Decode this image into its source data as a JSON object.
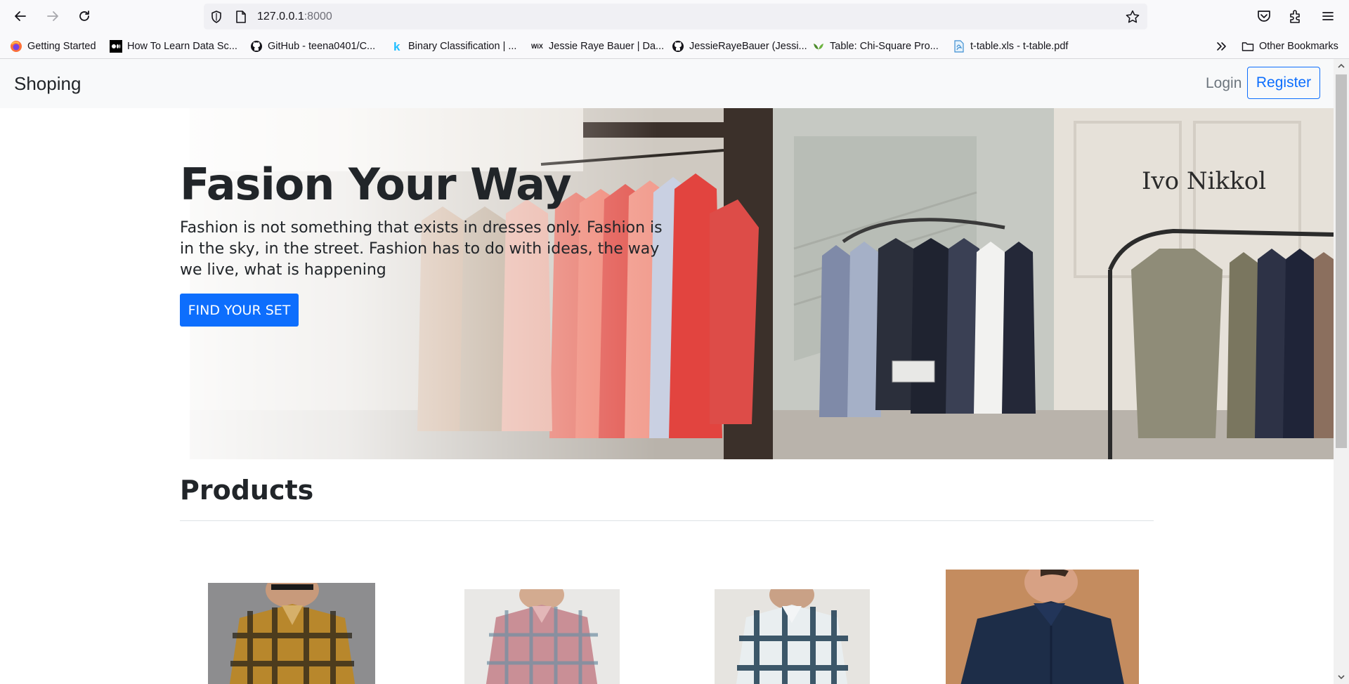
{
  "browser": {
    "url_host": "127.0.0.1",
    "url_port": ":8000",
    "bookmarks": [
      {
        "label": "Getting Started",
        "icon": "firefox-icon"
      },
      {
        "label": "How To Learn Data Sc...",
        "icon": "medium-icon"
      },
      {
        "label": "GitHub - teena0401/C...",
        "icon": "github-icon"
      },
      {
        "label": "Binary Classification | ...",
        "icon": "kaggle-icon"
      },
      {
        "label": "Jessie Raye Bauer | Da...",
        "icon": "wix-icon"
      },
      {
        "label": "JessieRayeBauer (Jessi...",
        "icon": "github-icon"
      },
      {
        "label": "Table: Chi-Square Pro...",
        "icon": "leaf-icon"
      },
      {
        "label": "t-table.xls - t-table.pdf",
        "icon": "pdf-icon"
      }
    ],
    "other_bookmarks": "Other Bookmarks"
  },
  "navbar": {
    "brand": "Shoping",
    "login": "Login",
    "register": "Register"
  },
  "hero": {
    "title": "Fasion Your Way",
    "text": "Fashion is not something that exists in dresses only. Fashion is in the sky, in the street. Fashion has to do with ideas, the way we live, what is happening",
    "button": "FIND YOUR SET",
    "store_sign": "Ivo Nikkol"
  },
  "products": {
    "title": "Products"
  },
  "colors": {
    "primary": "#0d6efd",
    "navbar_bg": "#f8f9fa",
    "text": "#212529"
  }
}
